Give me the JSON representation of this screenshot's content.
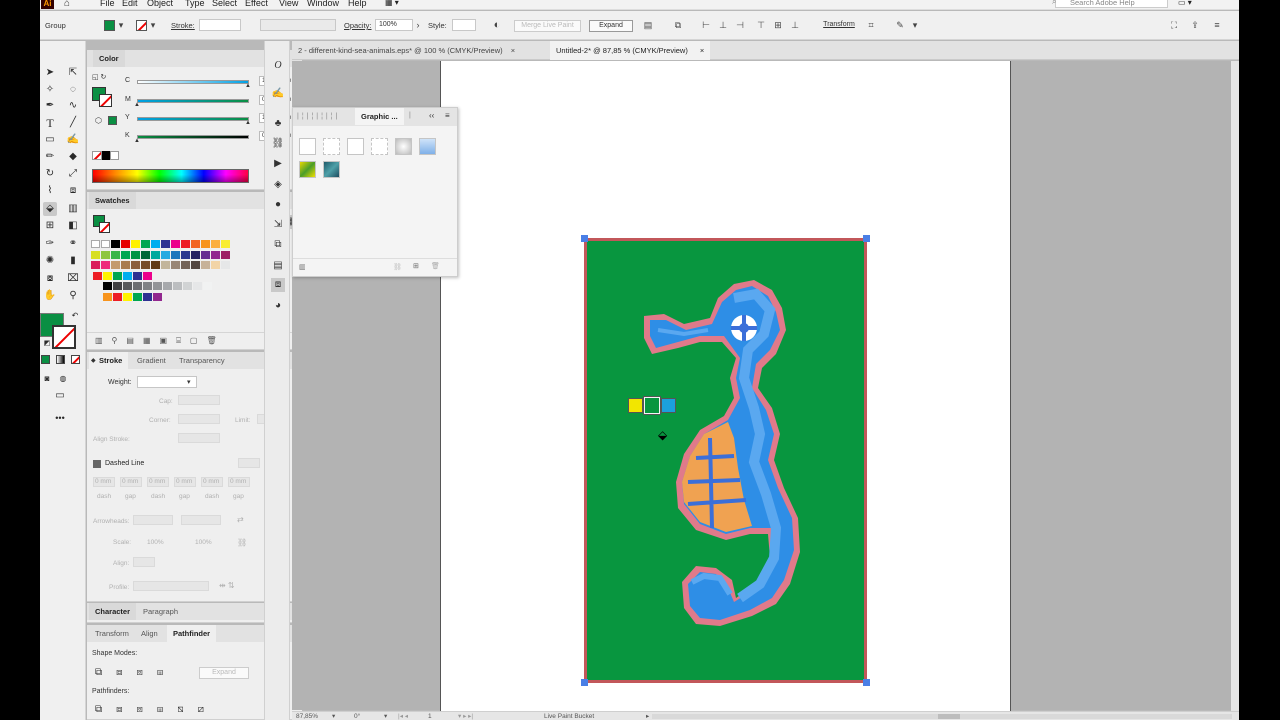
{
  "app": {
    "logo": "Ai",
    "home_icon": "home-icon"
  },
  "menu": [
    "File",
    "Edit",
    "Object",
    "Type",
    "Select",
    "Effect",
    "View",
    "Window",
    "Help"
  ],
  "search": {
    "placeholder": "Search Adobe Help"
  },
  "control_bar": {
    "selection_label": "Group",
    "fill_color": "#0a8f43",
    "stroke_label": "Stroke:",
    "opacity_label": "Opacity:",
    "opacity_value": "100%",
    "style_label": "Style:",
    "merge_button": "Merge Live Paint",
    "expand_button": "Expand",
    "transform_button": "Transform"
  },
  "document_tabs": [
    {
      "label": "2 - different-kind-sea-animals.eps* @ 100 % (CMYK/Preview)",
      "close": "×"
    },
    {
      "label": "Untitled-2* @ 87,85 % (CMYK/Preview)",
      "close": "×",
      "active": true
    }
  ],
  "color_panel": {
    "title": "Color",
    "sliders": [
      {
        "label": "C",
        "value": "100",
        "unit": "%"
      },
      {
        "label": "M",
        "value": "0",
        "unit": "%"
      },
      {
        "label": "Y",
        "value": "100",
        "unit": "%"
      },
      {
        "label": "K",
        "value": "0",
        "unit": "%"
      }
    ],
    "fill_color": "#0a8f43"
  },
  "swatches_panel": {
    "title": "Swatches"
  },
  "stroke_panel": {
    "tabs": [
      "Stroke",
      "Gradient",
      "Transparency"
    ],
    "weight_label": "Weight:",
    "cap_label": "Cap:",
    "corner_label": "Corner:",
    "limit_label": "Limit:",
    "align_label": "Align Stroke:",
    "dashed_label": "Dashed Line",
    "dash_fields": [
      "0 mm",
      "0 mm",
      "0 mm",
      "0 mm",
      "0 mm",
      "0 mm"
    ],
    "dash_labels": [
      "dash",
      "gap",
      "dash",
      "gap",
      "dash",
      "gap"
    ],
    "arrowheads_label": "Arrowheads:",
    "scale_label": "Scale:",
    "scale_values": [
      "100%",
      "100%"
    ],
    "align_arrow_label": "Align:",
    "profile_label": "Profile:"
  },
  "character_panel": {
    "tabs": [
      "Character",
      "Paragraph"
    ]
  },
  "pathfinder_panel": {
    "tabs": [
      "Transform",
      "Align",
      "Pathfinder"
    ],
    "shape_modes_label": "Shape Modes:",
    "expand_button": "Expand",
    "pathfinders_label": "Pathfinders:"
  },
  "graphic_styles_panel": {
    "title": "Graphic ..."
  },
  "status_bar": {
    "zoom": "87,85%",
    "rotation": "0°",
    "artboard": "1",
    "tool": "Live Paint Bucket"
  },
  "live_paint_swatches": [
    "#f2e600",
    "#08963f",
    "#1ba0dc"
  ],
  "artwork": {
    "background": "#08963f",
    "stroke": "#c2575a",
    "seahorse_body": "#2e8ee6",
    "seahorse_dark": "#3b6fd9",
    "belly": "#f0a251",
    "outline": "#e07a8a"
  }
}
